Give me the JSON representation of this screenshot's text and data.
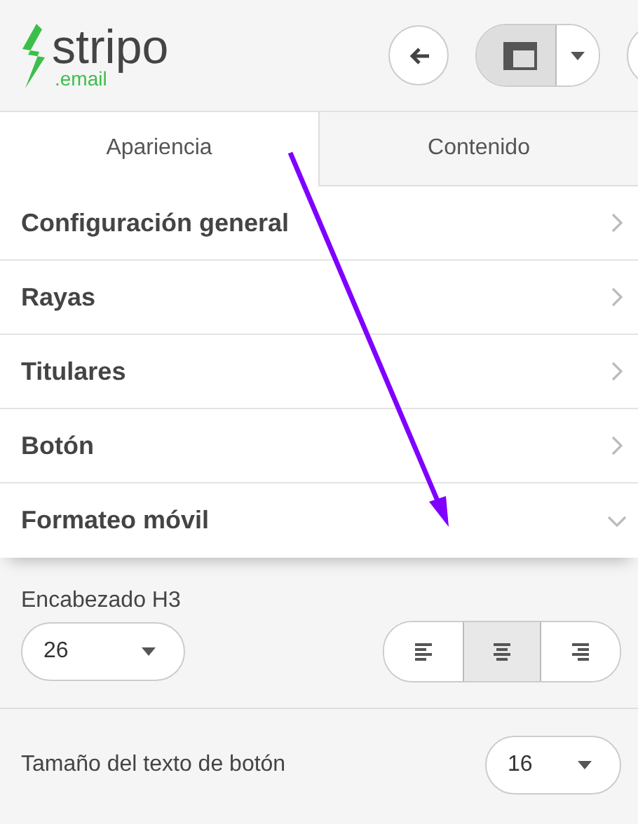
{
  "logo": {
    "name": "stripo",
    "suffix": ".email"
  },
  "toolbar": {
    "view_toggle_selected": true
  },
  "tabs": [
    {
      "label": "Apariencia",
      "selected": true
    },
    {
      "label": "Contenido",
      "selected": false
    }
  ],
  "sections": [
    {
      "label": "Configuración general",
      "expanded": false
    },
    {
      "label": "Rayas",
      "expanded": false
    },
    {
      "label": "Titulares",
      "expanded": false
    },
    {
      "label": "Botón",
      "expanded": false
    },
    {
      "label": "Formateo móvil",
      "expanded": true
    }
  ],
  "mobile": {
    "heading": {
      "label": "Encabezado H3",
      "value": "26",
      "align": [
        {
          "kind": "left",
          "selected": false
        },
        {
          "kind": "center",
          "selected": true
        },
        {
          "kind": "right",
          "selected": false
        }
      ]
    },
    "button_text": {
      "label": "Tamaño del texto de botón",
      "value": "16"
    }
  }
}
